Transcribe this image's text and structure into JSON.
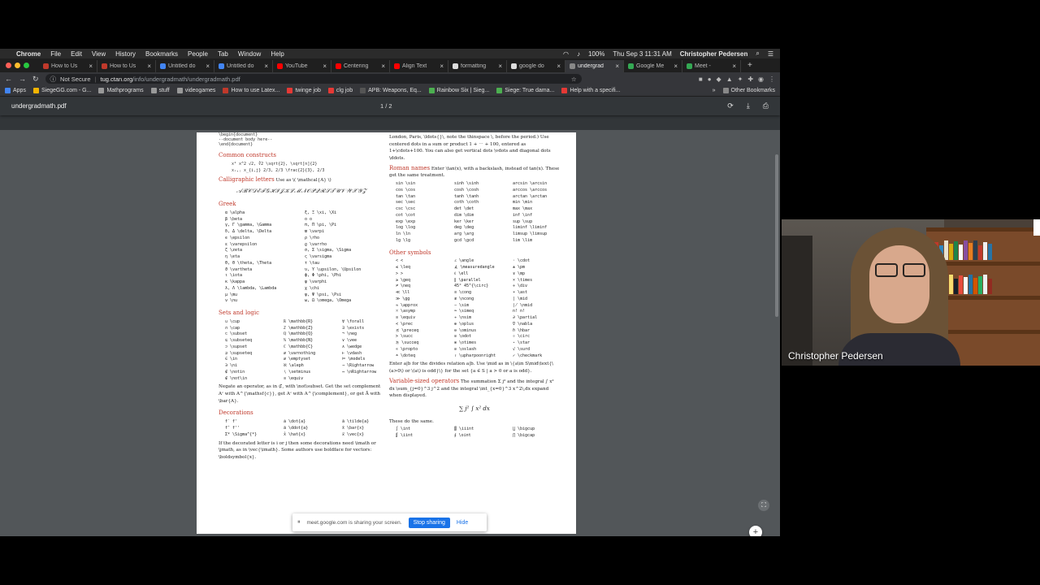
{
  "menubar": {
    "app": "Chrome",
    "items": [
      "File",
      "Edit",
      "View",
      "History",
      "Bookmarks",
      "People",
      "Tab",
      "Window",
      "Help"
    ],
    "battery": "100%",
    "datetime": "Thu Sep 3  11:31 AM",
    "user": "Christopher Pedersen"
  },
  "tabs": [
    {
      "label": "How to Us",
      "color": "#c0392b"
    },
    {
      "label": "How to Us",
      "color": "#c0392b"
    },
    {
      "label": "Untitled do",
      "color": "#4285f4"
    },
    {
      "label": "Untitled do",
      "color": "#4285f4"
    },
    {
      "label": "YouTube",
      "color": "#ff0000"
    },
    {
      "label": "Centering",
      "color": "#ff0000"
    },
    {
      "label": "Align Text",
      "color": "#ff0000"
    },
    {
      "label": "formatting",
      "color": "#dddddd"
    },
    {
      "label": "google do",
      "color": "#dddddd"
    },
    {
      "label": "undergrad",
      "color": "#888888",
      "active": true
    },
    {
      "label": "Google Me",
      "color": "#34a853"
    },
    {
      "label": "Meet -",
      "color": "#34a853"
    }
  ],
  "omnibox": {
    "security": "Not Secure",
    "host": "tug.ctan.org",
    "path": "/info/undergradmath/undergradmath.pdf"
  },
  "bookmarks": [
    {
      "label": "Apps",
      "color": "#4285f4"
    },
    {
      "label": "SiegeGG.com - G...",
      "color": "#f4b400"
    },
    {
      "label": "Mathprograms",
      "color": "#999"
    },
    {
      "label": "stuff",
      "color": "#999"
    },
    {
      "label": "videogames",
      "color": "#999"
    },
    {
      "label": "How to use Latex...",
      "color": "#c0392b"
    },
    {
      "label": "twinge job",
      "color": "#e53935"
    },
    {
      "label": "clg job",
      "color": "#e53935"
    },
    {
      "label": "APB: Weapons, Eq...",
      "color": "#555"
    },
    {
      "label": "Rainbow Six | Sieg...",
      "color": "#4caf50"
    },
    {
      "label": "Siege: True dama...",
      "color": "#4caf50"
    },
    {
      "label": "Help with a specifi...",
      "color": "#e53935"
    }
  ],
  "bookmarks_other": "Other Bookmarks",
  "pdf": {
    "filename": "undergradmath.pdf",
    "page_indicator": "1 / 2"
  },
  "doc": {
    "top_code": [
      "\\begin{document}",
      "  --document body here--",
      "\\end{document}"
    ],
    "common_title": "Common constructs",
    "common_rows": [
      "x²   x^2        √2, ∛2   \\sqrt{2}, \\sqrt[n]{2}",
      "xᵢ,ⱼ  x_{i,j}     2/3, 2/3   \\frac{2}{3}, 2/3"
    ],
    "calli_title": "Calligraphic letters",
    "calli_text": "Use as \\( \\mathcal{A} \\)",
    "calli_sample": "𝒜ℬ𝒞𝒟ℰℱ𝒢ℋℐ𝒥𝒦ℒℳ𝒩𝒪𝒫𝒬ℛ𝒮𝒯𝒰𝒱𝒲𝒳𝒴𝒵",
    "greek_title": "Greek",
    "greek": [
      "α \\alpha",
      "ξ, Ξ \\xi, \\Xi",
      "β \\beta",
      "ο o",
      "γ, Γ \\gamma, \\Gamma",
      "π, Π \\pi, \\Pi",
      "δ, Δ \\delta, \\Delta",
      "ϖ \\varpi",
      "ϵ \\epsilon",
      "ρ \\rho",
      "ε \\varepsilon",
      "ϱ \\varrho",
      "ζ \\zeta",
      "σ, Σ \\sigma, \\Sigma",
      "η \\eta",
      "ς \\varsigma",
      "θ, Θ \\theta, \\Theta",
      "τ \\tau",
      "ϑ \\vartheta",
      "υ, Υ \\upsilon, \\Upsilon",
      "ι \\iota",
      "ϕ, Φ \\phi, \\Phi",
      "κ \\kappa",
      "φ \\varphi",
      "λ, Λ \\lambda, \\Lambda",
      "χ \\chi",
      "μ \\mu",
      "ψ, Ψ \\psi, \\Psi",
      "ν \\nu",
      "ω, Ω \\omega, \\Omega"
    ],
    "sets_title": "Sets and logic",
    "sets": [
      "∪ \\cup",
      "ℝ \\mathbb{R}",
      "∀ \\forall",
      "∩ \\cap",
      "ℤ \\mathbb{Z}",
      "∃ \\exists",
      "⊂ \\subset",
      "ℚ \\mathbb{Q}",
      "¬ \\neg",
      "⊆ \\subseteq",
      "ℕ \\mathbb{N}",
      "∨ \\vee",
      "⊃ \\supset",
      "ℂ \\mathbb{C}",
      "∧ \\wedge",
      "⊇ \\supseteq",
      "∅ \\varnothing",
      "⊢ \\vdash",
      "∈ \\in",
      "∅ \\emptyset",
      "⊨ \\models",
      "∋ \\ni",
      "ℵ \\aleph",
      "⇒ \\Rightarrow",
      "∉ \\notin",
      "∖ \\setminus",
      "⇔ \\nRightarrow",
      "∉ \\not\\in",
      "≡ \\equiv",
      ""
    ],
    "negate_para": "Negate an operator, as in ⊄, with \\not\\subset. Get the set complement Aᶜ with A^{\\mathsf{c}}, get Aᶜ with A^{\\complement}, or get Ā with \\bar{A}.",
    "deco_title": "Decorations",
    "deco": [
      "f′ f'",
      "ȧ \\dot{a}",
      "ã \\tilde{a}",
      "f″ f''",
      "ä \\ddot{a}",
      "x̄ \\bar{x}",
      "Σ* \\Sigma^{*}",
      "x̂ \\hat{x}",
      "x⃗ \\vec{x}"
    ],
    "deco_para": "If the decorated letter is i or j then some decorations need \\imath or \\jmath, as in \\vec{\\imath}. Some authors use boldface for vectors: \\boldsymbol{x}.",
    "right_top": "London, Paris, \\ldots{}\\, note the thinspace \\, before the period.) Use centered dots in a sum or product 1 + ⋯ + 100, entered as 1+\\cdots+100. You can also get vertical dots \\vdots and diagonal dots \\ddots.",
    "roman_title": "Roman names",
    "roman_text": "Enter \\tan(x), with a backslash, instead of tan(x). These get the same treatment.",
    "roman": [
      "sin \\sin",
      "sinh \\sinh",
      "arcsin \\arcsin",
      "cos \\cos",
      "cosh \\cosh",
      "arccos \\arccos",
      "tan \\tan",
      "tanh \\tanh",
      "arctan \\arctan",
      "sec \\sec",
      "coth \\coth",
      "min \\min",
      "csc \\csc",
      "det \\det",
      "max \\max",
      "cot \\cot",
      "dim \\dim",
      "inf \\inf",
      "exp \\exp",
      "ker \\ker",
      "sup \\sup",
      "log \\log",
      "deg \\deg",
      "liminf \\liminf",
      "ln \\ln",
      "arg \\arg",
      "limsup \\limsup",
      "lg \\lg",
      "gcd \\gcd",
      "lim \\lim"
    ],
    "other_title": "Other symbols",
    "other": [
      "< <",
      "∠ \\angle",
      "· \\cdot",
      "≤ \\leq",
      "∡ \\measuredangle",
      "± \\pm",
      "> >",
      "ℓ \\ell",
      "∓ \\mp",
      "≥ \\geq",
      "∥ \\parallel",
      "× \\times",
      "≠ \\neq",
      "45° 45^{\\circ}",
      "÷ \\div",
      "≪ \\ll",
      "≅ \\cong",
      "∗ \\ast",
      "≫ \\gg",
      "≇ \\ncong",
      "| \\mid",
      "≈ \\approx",
      "∼ \\sim",
      "∤ \\nmid",
      "≍ \\asymp",
      "≃ \\simeq",
      "n! n!",
      "≡ \\equiv",
      "≁ \\nsim",
      "∂ \\partial",
      "≺ \\prec",
      "⊕ \\oplus",
      "∇ \\nabla",
      "⪯ \\preceq",
      "⊖ \\ominus",
      "ℏ \\hbar",
      "≻ \\succ",
      "⊙ \\odot",
      "∘ \\circ",
      "⪰ \\succeq",
      "⊗ \\otimes",
      "⋆ \\star",
      "∝ \\propto",
      "⊘ \\oslash",
      "√ \\surd",
      "≐ \\doteq",
      "↾ \\upharpoonright",
      "✓ \\checkmark"
    ],
    "divides_para": "Enter a|b for the divides relation a|b. Use \\mid as in \\{a\\in S\\mid\\text{\\(a>0\\) or \\(a\\) is odd}\\} for the set {a ∈ S | a > 0 or a is odd}.",
    "varsize_title": "Variable-sized operators",
    "varsize_text": "The summation Σ j² and the integral ∫ x² dx \\sum_{j=0}^3 j^2 and the integral \\int_{x=0}^3 x^2\\,dx expand when displayed.",
    "varsize_display": "∑ j²        ∫ x² dx",
    "same_text": "These do the same.",
    "ints": [
      "∫ \\int",
      "∭ \\iiint",
      "⋃ \\bigcup",
      "∬ \\iint",
      "∮ \\oint",
      "⋂ \\bigcap"
    ]
  },
  "share_bar": {
    "message": "meet.google.com is sharing your screen.",
    "stop": "Stop sharing",
    "hide": "Hide"
  },
  "video": {
    "name": "Christopher Pedersen"
  }
}
